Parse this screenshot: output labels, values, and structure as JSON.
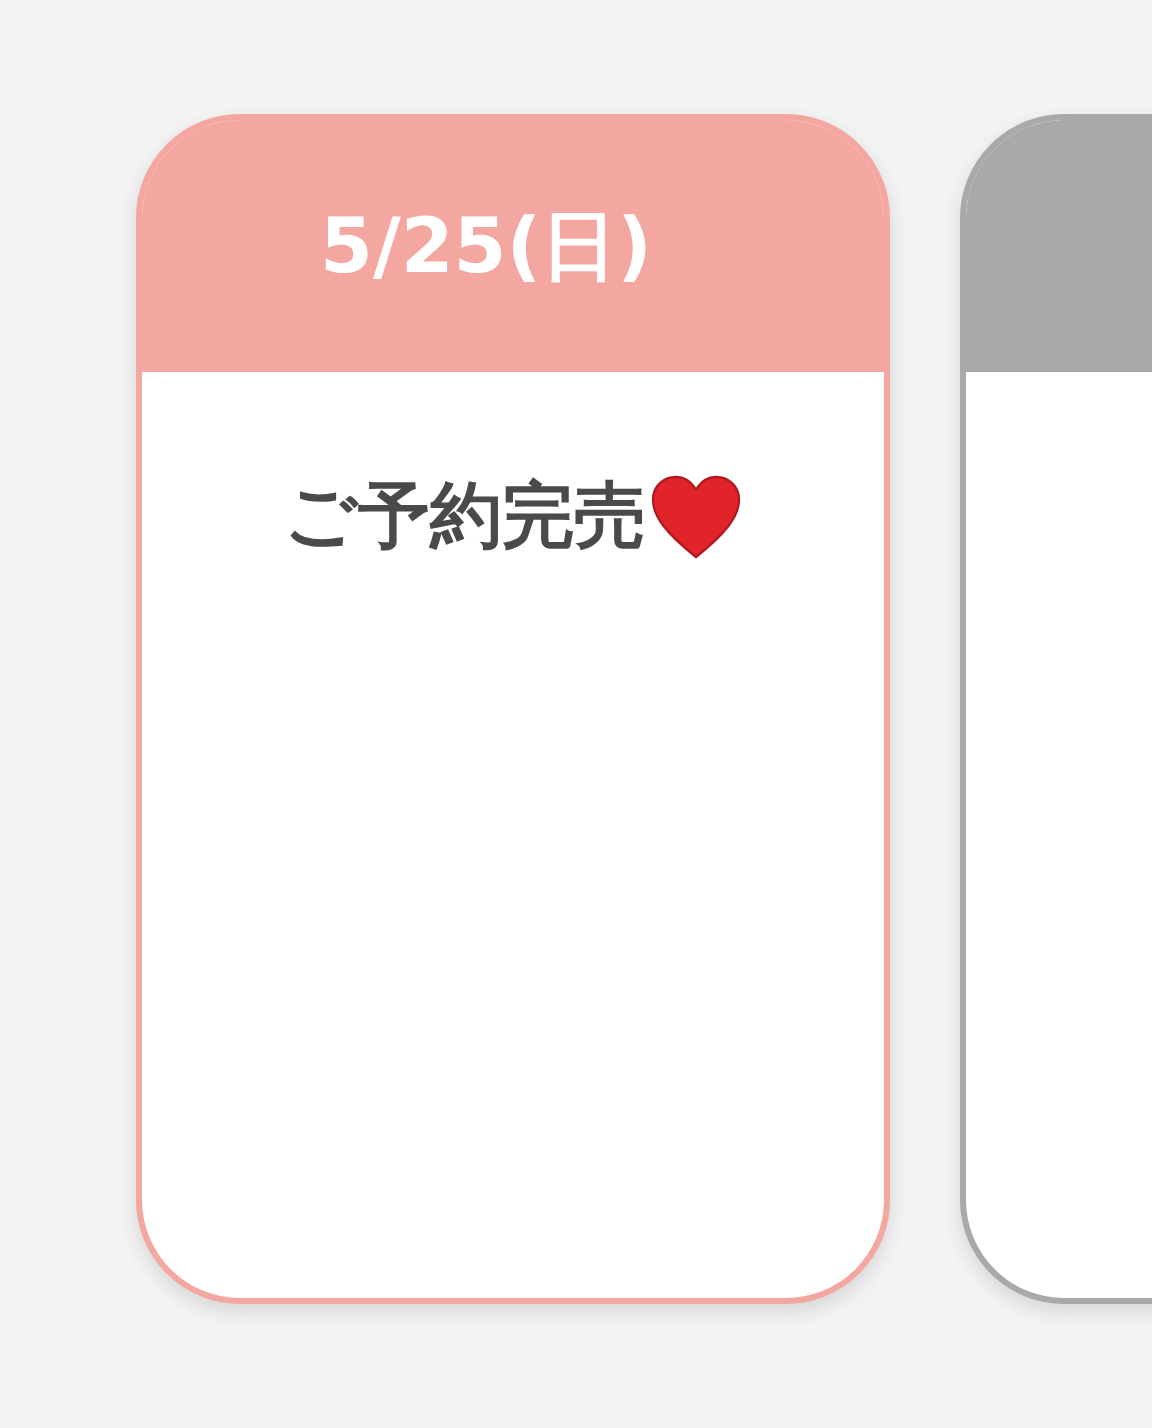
{
  "cards": [
    {
      "date": "5/25(日)",
      "color": "#f4a6a0",
      "status": "ご予約完売"
    },
    {
      "color": "#a9a9a9"
    }
  ]
}
